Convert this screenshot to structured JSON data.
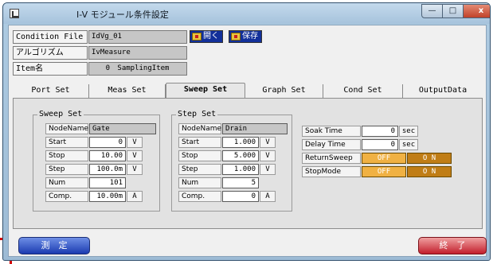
{
  "window": {
    "title": "I-V モジュール条件設定",
    "minimize_glyph": "—",
    "maximize_glyph": "□",
    "close_glyph": "x"
  },
  "header": {
    "condition_file_label": "Condition File",
    "condition_file_value": "IdVg_01",
    "algorithm_label": "アルゴリズム",
    "algorithm_value": "IvMeasure",
    "item_label": "Item名",
    "item_number": "0",
    "item_value": "SamplingItem",
    "open_button": "開く",
    "save_button": "保存"
  },
  "tabs": [
    {
      "label": "Port Set",
      "active": false
    },
    {
      "label": "Meas Set",
      "active": false
    },
    {
      "label": "Sweep Set",
      "active": true
    },
    {
      "label": "Graph Set",
      "active": false
    },
    {
      "label": "Cond Set",
      "active": false
    },
    {
      "label": "OutputData",
      "active": false
    }
  ],
  "sweep_set": {
    "title": "Sweep Set",
    "nodename_label": "NodeName",
    "nodename_value": "Gate",
    "start_label": "Start",
    "start_value": "0",
    "start_unit": "V",
    "stop_label": "Stop",
    "stop_value": "10.00",
    "stop_unit": "V",
    "step_label": "Step",
    "step_value": "100.0m",
    "step_unit": "V",
    "num_label": "Num",
    "num_value": "101",
    "comp_label": "Comp.",
    "comp_value": "10.00m",
    "comp_unit": "A"
  },
  "step_set": {
    "title": "Step Set",
    "nodename_label": "NodeName",
    "nodename_value": "Drain",
    "start_label": "Start",
    "start_value": "1.000",
    "start_unit": "V",
    "stop_label": "Stop",
    "stop_value": "5.000",
    "stop_unit": "V",
    "step_label": "Step",
    "step_value": "1.000",
    "step_unit": "V",
    "num_label": "Num",
    "num_value": "5",
    "comp_label": "Comp.",
    "comp_value": "0",
    "comp_unit": "A"
  },
  "timing": {
    "soak_label": "Soak Time",
    "soak_value": "0",
    "soak_unit": "sec",
    "delay_label": "Delay Time",
    "delay_value": "0",
    "delay_unit": "sec",
    "return_sweep_label": "ReturnSweep",
    "stop_mode_label": "StopMode",
    "off_label": "OFF",
    "on_label": "O N"
  },
  "buttons": {
    "measure": "測　定",
    "exit": "終　了"
  },
  "colors": {
    "title_gradient_top": "#c3d9ec",
    "measure_button": "#1b3bb0",
    "exit_button": "#c21e2c",
    "toggle_off": "#f0b143",
    "toggle_on": "#c07d16",
    "marker": "#d40000"
  }
}
